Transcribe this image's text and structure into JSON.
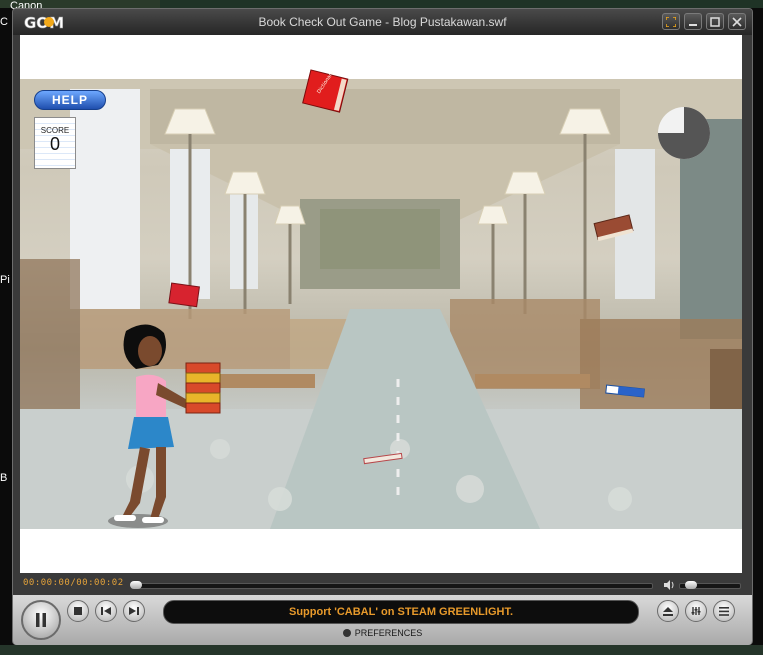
{
  "desktop": {
    "labels": [
      "Canon",
      "C",
      "Pi",
      "B"
    ]
  },
  "window": {
    "logo": "GOM",
    "title": "Book Check Out Game - Blog Pustakawan.swf",
    "buttons": [
      "fullscreen-icon",
      "minimize-icon",
      "maximize-icon",
      "close-icon"
    ]
  },
  "game": {
    "help_label": "HELP",
    "score_label": "SCORE",
    "score_value": "0",
    "book_label": "Dictionary",
    "timer_fraction_remaining": 0.75
  },
  "player": {
    "timecode": "00:00:00/00:00:02",
    "seek_progress": 0.0,
    "volume_level": 0.1,
    "marquee": "Support 'CABAL' on STEAM GREENLIGHT.",
    "preferences_label": "PREFERENCES",
    "accent_color": "#e89a2b"
  }
}
